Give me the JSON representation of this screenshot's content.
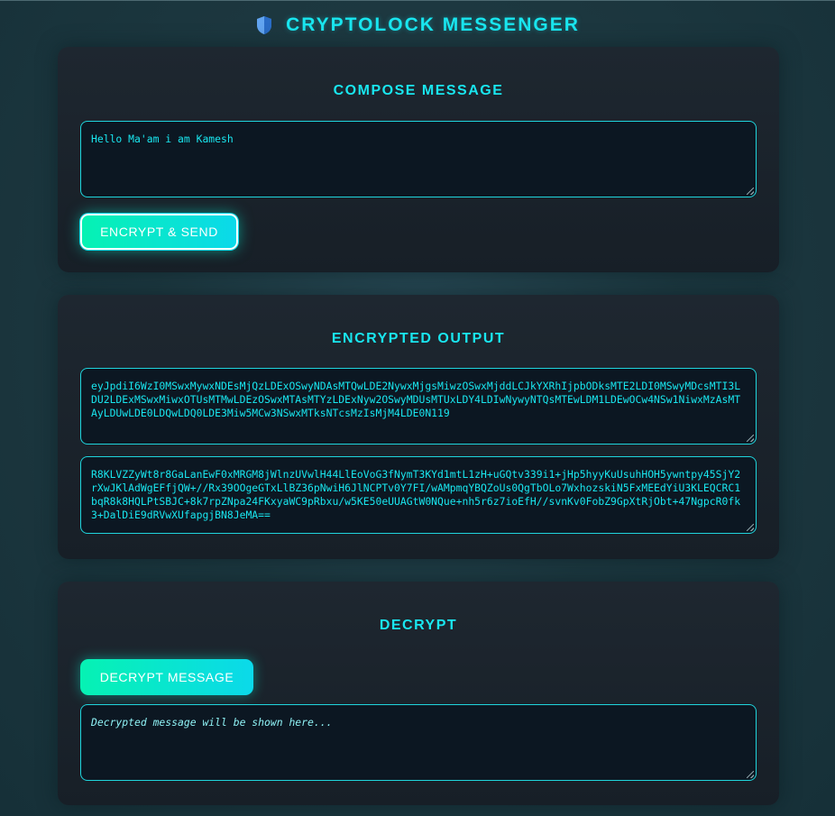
{
  "app": {
    "title": "CRYPTOLOCK MESSENGER",
    "logo_icon": "shield-icon"
  },
  "compose": {
    "title": "COMPOSE MESSAGE",
    "message_value": "Hello Ma'am i am Kamesh",
    "encrypt_button_label": "ENCRYPT & SEND"
  },
  "output": {
    "title": "ENCRYPTED OUTPUT",
    "payload_value": "eyJpdiI6WzI0MSwxMywxNDEsMjQzLDExOSwyNDAsMTQwLDE2NywxMjgsMiwzOSwxMjddLCJkYXRhIjpbODksMTE2LDI0MSwyMDcsMTI3LDU2LDExMSwxMiwxOTUsMTMwLDEzOSwxMTAsMTYzLDExNyw2OSwyMDUsMTUxLDY4LDIwNywyNTQsMTEwLDM1LDEwOCw4NSw1NiwxMzAsMTAyLDUwLDE0LDQwLDQ0LDE3Miw5MCw3NSwxMTksNTcsMzIsMjM4LDE0N119",
    "cipher_value": "R8KLVZZyWt8r8GaLanEwF0xMRGM8jWlnzUVwlH44LlEoVoG3fNymT3KYd1mtL1zH+uGQtv339i1+jHp5hyyKuUsuhHOH5ywntpy45SjY2rXwJKlAdWgEFfjQW+//Rx39OOgeGTxLlBZ36pNwiH6JlNCPTv0Y7FI/wAMpmqYBQZoUs0QgTbOLo7WxhozskiN5FxMEEdYiU3KLEQCRC1bqR8k8HQLPtSBJC+8k7rpZNpa24FKxyaWC9pRbxu/w5KE50eUUAGtW0NQue+nh5r6z7ioEfH//svnKv0FobZ9GpXtRjObt+47NgpcR0fk3+DalDiE9dRVwXUfapgjBN8JeMA=="
  },
  "decrypt": {
    "title": "DECRYPT",
    "decrypt_button_label": "DECRYPT MESSAGE",
    "result_placeholder": "Decrypted message will be shown here..."
  },
  "colors": {
    "accent": "#19e6ef",
    "button_start": "#06f2b3",
    "button_end": "#0bd9ea",
    "card": "#1b232c",
    "field": "#0c1722"
  }
}
